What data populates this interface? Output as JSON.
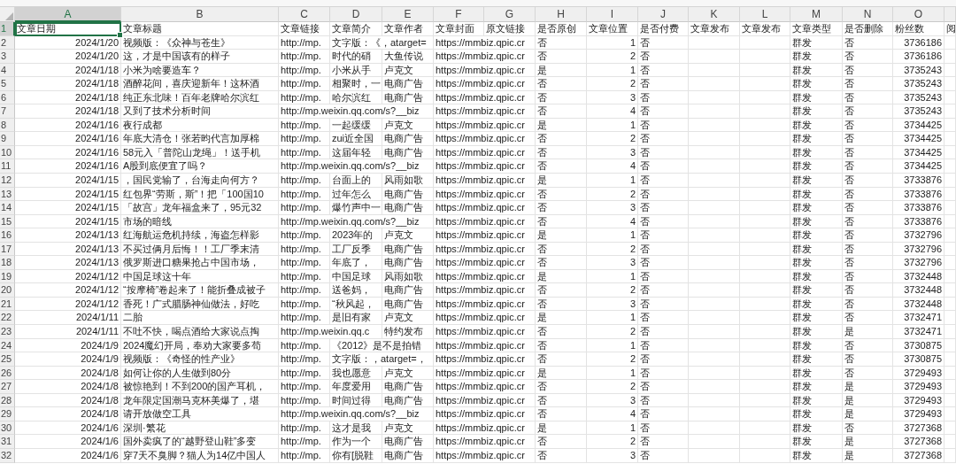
{
  "columns": [
    {
      "label": "A",
      "selected": true
    },
    {
      "label": "B",
      "selected": false
    },
    {
      "label": "C",
      "selected": false
    },
    {
      "label": "D",
      "selected": false
    },
    {
      "label": "E",
      "selected": false
    },
    {
      "label": "F",
      "selected": false
    },
    {
      "label": "G",
      "selected": false
    },
    {
      "label": "H",
      "selected": false
    },
    {
      "label": "I",
      "selected": false
    },
    {
      "label": "J",
      "selected": false
    },
    {
      "label": "K",
      "selected": false
    },
    {
      "label": "L",
      "selected": false
    },
    {
      "label": "M",
      "selected": false
    },
    {
      "label": "N",
      "selected": false
    },
    {
      "label": "O",
      "selected": false
    }
  ],
  "rows": [
    {
      "number": "1",
      "selected": true,
      "cells": {
        "A": "文章日期",
        "B": "文章标题",
        "C": "文章链接",
        "D": "文章简介",
        "E": "文章作者",
        "F": "文章封面",
        "G": "原文链接",
        "H": "是否原创",
        "I": "文章位置",
        "J": "是否付费",
        "K": "文章发布",
        "L": "文章发布",
        "M": "文章类型",
        "N": "是否删除",
        "O": "粉丝数",
        "column_16": "阅"
      }
    },
    {
      "number": "2",
      "selected": false,
      "cells": {
        "A": "2024/1/20",
        "B": "视频版：《众神与苍生》",
        "C": "http://mp.",
        "D": "文字版：《，atarget=",
        "F": "https://mmbiz.qpic.cr",
        "H": "否",
        "I": "1",
        "J": "否",
        "M": "群发",
        "N": "否",
        "O": "3736186"
      }
    },
    {
      "number": "3",
      "selected": false,
      "cells": {
        "A": "2024/1/20",
        "B": "这，才是中国该有的样子",
        "C": "http://mp.",
        "D": "时代的硝",
        "E": "大鱼传说",
        "F": "https://mmbiz.qpic.cr",
        "H": "否",
        "I": "2",
        "J": "否",
        "M": "群发",
        "N": "否",
        "O": "3736186"
      }
    },
    {
      "number": "4",
      "selected": false,
      "cells": {
        "A": "2024/1/18",
        "B": "小米为啥要造车？",
        "C": "http://mp.",
        "D": "小米从手",
        "E": "卢克文",
        "F": "https://mmbiz.qpic.cr",
        "H": "是",
        "I": "1",
        "J": "否",
        "M": "群发",
        "N": "否",
        "O": "3735243"
      }
    },
    {
      "number": "5",
      "selected": false,
      "cells": {
        "A": "2024/1/18",
        "B": "酒醉花间，喜庆迎新年！这杯酒",
        "C": "http://mp.",
        "D": "相聚时，一",
        "E": "电商广告",
        "F": "https://mmbiz.qpic.cr",
        "H": "否",
        "I": "2",
        "J": "否",
        "M": "群发",
        "N": "否",
        "O": "3735243"
      }
    },
    {
      "number": "6",
      "selected": false,
      "cells": {
        "A": "2024/1/18",
        "B": "纯正东北味！百年老牌哈尔滨红",
        "C": "http://mp.",
        "D": "哈尔滨红",
        "E": "电商广告",
        "F": "https://mmbiz.qpic.cr",
        "H": "否",
        "I": "3",
        "J": "否",
        "M": "群发",
        "N": "否",
        "O": "3735243"
      }
    },
    {
      "number": "7",
      "selected": false,
      "cells": {
        "A": "2024/1/18",
        "B": "又到了技术分析时间",
        "C": "http://mp.weixin.qq.com/s?__biz",
        "F": "https://mmbiz.qpic.cr",
        "H": "否",
        "I": "4",
        "J": "否",
        "M": "群发",
        "N": "否",
        "O": "3735243"
      }
    },
    {
      "number": "8",
      "selected": false,
      "cells": {
        "A": "2024/1/16",
        "B": "夜行成都",
        "C": "http://mp.",
        "D": "一起缓缓",
        "E": "卢克文",
        "F": "https://mmbiz.qpic.cr",
        "H": "是",
        "I": "1",
        "J": "否",
        "M": "群发",
        "N": "否",
        "O": "3734425"
      }
    },
    {
      "number": "9",
      "selected": false,
      "cells": {
        "A": "2024/1/16",
        "B": "年底大清仓！张若昀代言加厚棉",
        "C": "http://mp.",
        "D": "zui近全国",
        "E": "电商广告",
        "F": "https://mmbiz.qpic.cr",
        "H": "否",
        "I": "2",
        "J": "否",
        "M": "群发",
        "N": "否",
        "O": "3734425"
      }
    },
    {
      "number": "10",
      "selected": false,
      "cells": {
        "A": "2024/1/16",
        "B": "58元入「普陀山龙绳」！送手机",
        "C": "http://mp.",
        "D": "这届年轻",
        "E": "电商广告",
        "F": "https://mmbiz.qpic.cr",
        "H": "否",
        "I": "3",
        "J": "否",
        "M": "群发",
        "N": "否",
        "O": "3734425"
      }
    },
    {
      "number": "11",
      "selected": false,
      "cells": {
        "A": "2024/1/16",
        "B": "A股到底便宜了吗？",
        "C": "http://mp.weixin.qq.com/s?__biz",
        "F": "https://mmbiz.qpic.cr",
        "H": "否",
        "I": "4",
        "J": "否",
        "M": "群发",
        "N": "否",
        "O": "3734425"
      }
    },
    {
      "number": "12",
      "selected": false,
      "cells": {
        "A": "2024/1/15",
        "B": "，国民党输了，台海走向何方？",
        "C": "http://mp.",
        "D": "台面上的",
        "E": "风雨如歌",
        "F": "https://mmbiz.qpic.cr",
        "H": "是",
        "I": "1",
        "J": "否",
        "M": "群发",
        "N": "否",
        "O": "3733876"
      }
    },
    {
      "number": "13",
      "selected": false,
      "cells": {
        "A": "2024/1/15",
        "B": "红包界“劳斯，斯”！把「100国10",
        "C": "http://mp.",
        "D": "过年怎么",
        "E": "电商广告",
        "F": "https://mmbiz.qpic.cr",
        "H": "否",
        "I": "2",
        "J": "否",
        "M": "群发",
        "N": "否",
        "O": "3733876"
      }
    },
    {
      "number": "14",
      "selected": false,
      "cells": {
        "A": "2024/1/15",
        "B": "「故宫」龙年福盒来了，95元32",
        "C": "http://mp.",
        "D": "爆竹声中一",
        "E": "电商广告",
        "F": "https://mmbiz.qpic.cr",
        "H": "否",
        "I": "3",
        "J": "否",
        "M": "群发",
        "N": "否",
        "O": "3733876"
      }
    },
    {
      "number": "15",
      "selected": false,
      "cells": {
        "A": "2024/1/15",
        "B": "市场的暗线",
        "C": "http://mp.weixin.qq.com/s?__biz",
        "F": "https://mmbiz.qpic.cr",
        "H": "否",
        "I": "4",
        "J": "否",
        "M": "群发",
        "N": "否",
        "O": "3733876"
      }
    },
    {
      "number": "16",
      "selected": false,
      "cells": {
        "A": "2024/1/13",
        "B": "红海航运危机持续，海盗怎样影",
        "C": "http://mp.",
        "D": "2023年的",
        "E": "卢克文",
        "F": "https://mmbiz.qpic.cr",
        "H": "是",
        "I": "1",
        "J": "否",
        "M": "群发",
        "N": "否",
        "O": "3732796"
      }
    },
    {
      "number": "17",
      "selected": false,
      "cells": {
        "A": "2024/1/13",
        "B": "不买过俩月后悔！！工厂季末清",
        "C": "http://mp.",
        "D": "工厂反季",
        "E": "电商广告",
        "F": "https://mmbiz.qpic.cr",
        "H": "否",
        "I": "2",
        "J": "否",
        "M": "群发",
        "N": "否",
        "O": "3732796"
      }
    },
    {
      "number": "18",
      "selected": false,
      "cells": {
        "A": "2024/1/13",
        "B": "俄罗斯进口糖果抢占中国市场，",
        "C": "http://mp.",
        "D": "年底了，",
        "E": "电商广告",
        "F": "https://mmbiz.qpic.cr",
        "H": "否",
        "I": "3",
        "J": "否",
        "M": "群发",
        "N": "否",
        "O": "3732796"
      }
    },
    {
      "number": "19",
      "selected": false,
      "cells": {
        "A": "2024/1/12",
        "B": "中国足球这十年",
        "C": "http://mp.",
        "D": "中国足球",
        "E": "风雨如歌",
        "F": "https://mmbiz.qpic.cr",
        "H": "是",
        "I": "1",
        "J": "否",
        "M": "群发",
        "N": "否",
        "O": "3732448"
      }
    },
    {
      "number": "20",
      "selected": false,
      "cells": {
        "A": "2024/1/12",
        "B": "“按摩椅”卷起来了！能折叠成被子",
        "C": "http://mp.",
        "D": "送爸妈，",
        "E": "电商广告",
        "F": "https://mmbiz.qpic.cr",
        "H": "否",
        "I": "2",
        "J": "否",
        "M": "群发",
        "N": "否",
        "O": "3732448"
      }
    },
    {
      "number": "21",
      "selected": false,
      "cells": {
        "A": "2024/1/12",
        "B": "香死！广式腊肠神仙做法，好吃",
        "C": "http://mp.",
        "D": "“秋风起，",
        "E": "电商广告",
        "F": "https://mmbiz.qpic.cr",
        "H": "否",
        "I": "3",
        "J": "否",
        "M": "群发",
        "N": "否",
        "O": "3732448"
      }
    },
    {
      "number": "22",
      "selected": false,
      "cells": {
        "A": "2024/1/11",
        "B": "二胎",
        "C": "http://mp.",
        "D": "是旧有家",
        "E": "卢克文",
        "F": "https://mmbiz.qpic.cr",
        "H": "是",
        "I": "1",
        "J": "否",
        "M": "群发",
        "N": "否",
        "O": "3732471"
      }
    },
    {
      "number": "23",
      "selected": false,
      "cells": {
        "A": "2024/1/11",
        "B": "不吐不快，喝点酒给大家说点掏",
        "C": "http://mp.weixin.qq.c",
        "E": "特约发布",
        "F": "https://mmbiz.qpic.cr",
        "H": "否",
        "I": "2",
        "J": "否",
        "M": "群发",
        "N": "是",
        "O": "3732471"
      }
    },
    {
      "number": "24",
      "selected": false,
      "cells": {
        "A": "2024/1/9",
        "B": "2024魔幻开局，奉劝大家要多苟",
        "C": "http://mp.",
        "D": "《2012》是不是拍错",
        "F": "https://mmbiz.qpic.cr",
        "H": "否",
        "I": "1",
        "J": "否",
        "M": "群发",
        "N": "否",
        "O": "3730875"
      }
    },
    {
      "number": "25",
      "selected": false,
      "cells": {
        "A": "2024/1/9",
        "B": "视频版：《奇怪的性产业》",
        "C": "http://mp.",
        "D": "文字版：，atarget=，",
        "F": "https://mmbiz.qpic.cr",
        "H": "否",
        "I": "2",
        "J": "否",
        "M": "群发",
        "N": "否",
        "O": "3730875"
      }
    },
    {
      "number": "26",
      "selected": false,
      "cells": {
        "A": "2024/1/8",
        "B": "如何让你的人生做到80分",
        "C": "http://mp.",
        "D": "我也愿意",
        "E": "卢克文",
        "F": "https://mmbiz.qpic.cr",
        "H": "是",
        "I": "1",
        "J": "否",
        "M": "群发",
        "N": "否",
        "O": "3729493"
      }
    },
    {
      "number": "27",
      "selected": false,
      "cells": {
        "A": "2024/1/8",
        "B": "被惊艳到！不到200的国产耳机，",
        "C": "http://mp.",
        "D": "年度爱用",
        "E": "电商广告",
        "F": "https://mmbiz.qpic.cr",
        "H": "否",
        "I": "2",
        "J": "否",
        "M": "群发",
        "N": "是",
        "O": "3729493"
      }
    },
    {
      "number": "28",
      "selected": false,
      "cells": {
        "A": "2024/1/8",
        "B": "龙年限定国潮马克杯美爆了，堪",
        "C": "http://mp.",
        "D": "时间过得",
        "E": "电商广告",
        "F": "https://mmbiz.qpic.cr",
        "H": "否",
        "I": "3",
        "J": "否",
        "M": "群发",
        "N": "是",
        "O": "3729493"
      }
    },
    {
      "number": "29",
      "selected": false,
      "cells": {
        "A": "2024/1/8",
        "B": "请开放做空工具",
        "C": "http://mp.weixin.qq.com/s?__biz",
        "F": "https://mmbiz.qpic.cr",
        "H": "否",
        "I": "4",
        "J": "否",
        "M": "群发",
        "N": "是",
        "O": "3729493"
      }
    },
    {
      "number": "30",
      "selected": false,
      "cells": {
        "A": "2024/1/6",
        "B": "深圳·繁花",
        "C": "http://mp.",
        "D": "这才是我",
        "E": "卢克文",
        "F": "https://mmbiz.qpic.cr",
        "H": "是",
        "I": "1",
        "J": "否",
        "M": "群发",
        "N": "否",
        "O": "3727368"
      }
    },
    {
      "number": "31",
      "selected": false,
      "cells": {
        "A": "2024/1/6",
        "B": "国外卖疯了的“越野登山鞋”多变",
        "C": "http://mp.",
        "D": "作为一个",
        "E": "电商广告",
        "F": "https://mmbiz.qpic.cr",
        "H": "否",
        "I": "2",
        "J": "否",
        "M": "群发",
        "N": "是",
        "O": "3727368"
      }
    },
    {
      "number": "32",
      "selected": false,
      "cells": {
        "A": "2024/1/6",
        "B": "穿7天不臭脚？猫人为14亿中国人",
        "C": "http://mp.",
        "D": "你有[脱鞋",
        "E": "电商广告",
        "F": "https://mmbiz.qpic.cr",
        "H": "否",
        "I": "3",
        "J": "否",
        "M": "群发",
        "N": "是",
        "O": "3727368"
      }
    }
  ]
}
